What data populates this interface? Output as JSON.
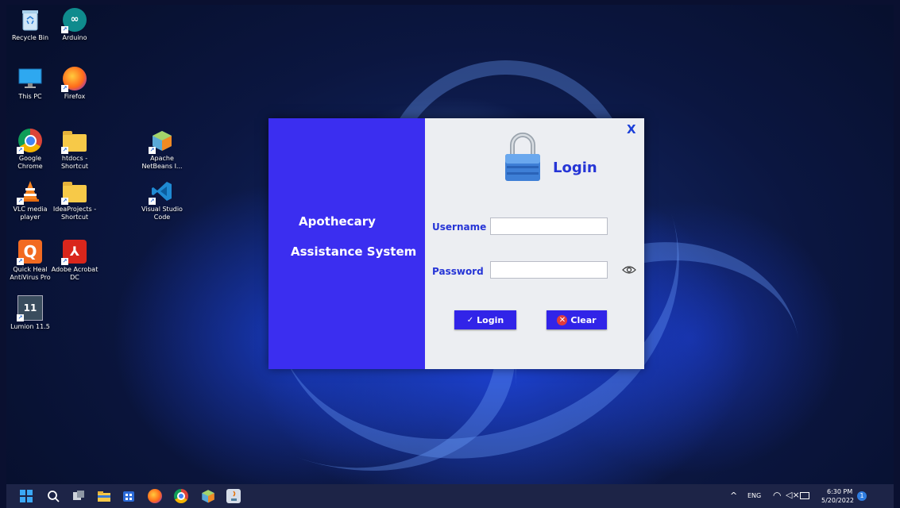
{
  "desktop": {
    "icons": [
      {
        "label": "Recycle Bin",
        "icon": "recycle-bin-icon"
      },
      {
        "label": "Arduino",
        "icon": "arduino-icon"
      },
      {
        "label": "This PC",
        "icon": "monitor-icon"
      },
      {
        "label": "Firefox",
        "icon": "firefox-icon"
      },
      {
        "label": "Google Chrome",
        "icon": "chrome-icon"
      },
      {
        "label": "htdocs - Shortcut",
        "icon": "folder-icon"
      },
      {
        "label": "Apache NetBeans I...",
        "icon": "netbeans-icon"
      },
      {
        "label": "VLC media player",
        "icon": "vlc-icon"
      },
      {
        "label": "IdeaProjects - Shortcut",
        "icon": "folder-icon"
      },
      {
        "label": "Visual Studio Code",
        "icon": "vscode-icon"
      },
      {
        "label": "Quick Heal AntiVirus Pro",
        "icon": "quickheal-icon"
      },
      {
        "label": "Adobe Acrobat DC",
        "icon": "acrobat-icon"
      },
      {
        "label": "Lumion 11.5",
        "icon": "lumion-icon"
      }
    ]
  },
  "dialog": {
    "app_name_line1": "Apothecary",
    "app_name_line2": "Assistance System",
    "close_label": "X",
    "title": "Login",
    "username_label": "Username",
    "username_value": "",
    "password_label": "Password",
    "password_value": "",
    "login_button": "Login",
    "login_button_icon": "✓",
    "clear_button": "Clear",
    "clear_button_icon": "✕",
    "colors": {
      "panel": "#3b2ef0",
      "accent": "#2635d6",
      "button": "#3124e8",
      "clear_icon": "#e13c3c"
    }
  },
  "taskbar": {
    "icons": [
      "windows-start-icon",
      "search-icon",
      "task-view-icon",
      "file-explorer-icon",
      "store-icon",
      "firefox-icon",
      "chrome-icon",
      "netbeans-icon",
      "java-icon"
    ],
    "tray": {
      "chevron": "^",
      "language": "ENG",
      "time": "6:30 PM",
      "date": "5/20/2022",
      "notification_count": "1"
    }
  }
}
